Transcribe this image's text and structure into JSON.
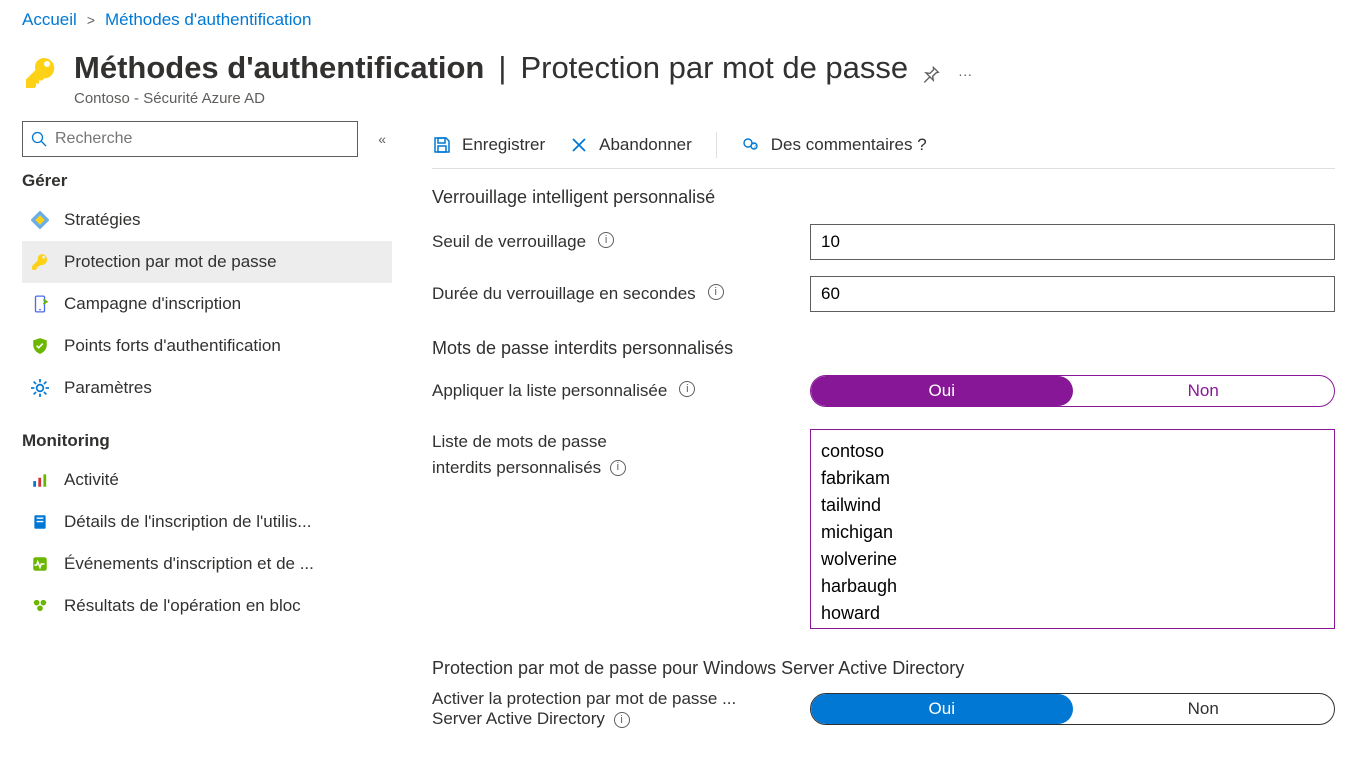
{
  "breadcrumb": {
    "home": "Accueil",
    "current": "Méthodes d'authentification"
  },
  "header": {
    "title_main": "Méthodes d'authentification",
    "title_sub": "Protection par mot de passe",
    "subtitle": "Contoso - Sécurité Azure AD"
  },
  "sidebar": {
    "search_placeholder": "Recherche",
    "sections": {
      "manage": "Gérer",
      "monitoring": "Monitoring"
    },
    "items": {
      "strategies": "Stratégies",
      "password_protection": "Protection par mot de passe",
      "registration_campaign": "Campagne d'inscription",
      "auth_strengths": "Points forts d'authentification",
      "settings": "Paramètres",
      "activity": "Activité",
      "reg_details": "Détails de l'inscription de l'utilis...",
      "reg_events": "Événements d'inscription et de ...",
      "bulk_results": "Résultats de l'opération en bloc"
    }
  },
  "toolbar": {
    "save": "Enregistrer",
    "discard": "Abandonner",
    "feedback": "Des commentaires ?"
  },
  "sections": {
    "smart_lockout": "Verrouillage intelligent personnalisé",
    "banned_passwords": "Mots de passe interdits personnalisés",
    "windows_ad": "Protection par mot de passe pour Windows Server Active Directory"
  },
  "fields": {
    "lockout_threshold_label": "Seuil de verrouillage",
    "lockout_threshold_value": "10",
    "lockout_duration_label": "Durée du verrouillage en secondes",
    "lockout_duration_value": "60",
    "enforce_custom_list_label": "Appliquer la liste personnalisée",
    "custom_list_label_line1": "Liste de mots de passe",
    "custom_list_label_line2": "interdits personnalisés",
    "custom_list_value": "contoso\nfabrikam\ntailwind\nmichigan\nwolverine\nharbaugh\nhoward",
    "enable_windows_ad_label_line1": "Activer la protection par mot de passe ...",
    "enable_windows_ad_label_line2": "Server Active Directory"
  },
  "toggle": {
    "yes": "Oui",
    "no": "Non"
  },
  "info_glyph": "i"
}
